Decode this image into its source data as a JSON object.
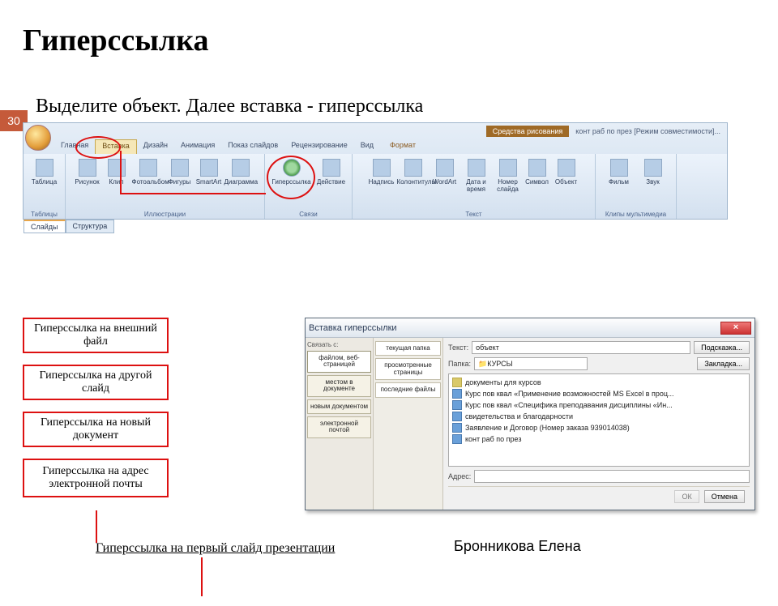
{
  "slide": {
    "title": "Гиперссылка",
    "page_number": "30",
    "instruction": "Выделите объект. Далее вставка - гиперссылка",
    "caption": "Гиперссылка на первый слайд презентации",
    "author": "Бронникова Елена"
  },
  "link_boxes": [
    "Гиперссылка на внешний файл",
    "Гиперссылка на другой слайд",
    "Гиперссылка на новый документ",
    "Гиперссылка на адрес электронной почты"
  ],
  "ribbon": {
    "tools_tab_title": "Средства рисования",
    "doc_name": "конт раб по през [Режим совместимости]...",
    "tabs": [
      "Главная",
      "Вставка",
      "Дизайн",
      "Анимация",
      "Показ слайдов",
      "Рецензирование",
      "Вид",
      "Формат"
    ],
    "active_tab_index": 1,
    "groups": {
      "tables": {
        "label": "Таблицы",
        "btn": "Таблица"
      },
      "illustrations": {
        "label": "Иллюстрации",
        "btns": [
          "Рисунок",
          "Клип",
          "Фотоальбом",
          "Фигуры",
          "SmartArt",
          "Диаграмма"
        ]
      },
      "links": {
        "label": "Связи",
        "btns": [
          "Гиперссылка",
          "Действие"
        ]
      },
      "text": {
        "label": "Текст",
        "btns": [
          "Надпись",
          "Колонтитулы",
          "WordArt",
          "Дата и время",
          "Номер слайда",
          "Символ",
          "Объект"
        ]
      },
      "media": {
        "label": "Клипы мультимедиа",
        "btns": [
          "Фильм",
          "Звук"
        ]
      }
    },
    "pane_tabs": [
      "Слайды",
      "Структура"
    ]
  },
  "dialog": {
    "title": "Вставка гиперссылки",
    "link_to_label": "Связать с:",
    "text_label": "Текст:",
    "text_value": "объект",
    "folder_label": "Папка:",
    "folder_value": "КУРСЫ",
    "address_label": "Адрес:",
    "address_value": "",
    "hint_btn": "Подсказка...",
    "bookmark_btn": "Закладка...",
    "ok_btn": "ОК",
    "cancel_btn": "Отмена",
    "left_panel": [
      "файлом, веб-страницей",
      "местом в документе",
      "новым документом",
      "электронной почтой"
    ],
    "mid_panel": [
      "текущая папка",
      "просмотренные страницы",
      "последние файлы"
    ],
    "files": [
      {
        "icon": "folder",
        "name": "документы для курсов"
      },
      {
        "icon": "doc",
        "name": "Курс пов квал «Применение возможностей MS Excel в проц..."
      },
      {
        "icon": "doc",
        "name": "Курс пов квал «Специфика преподавания дисциплины «Ин..."
      },
      {
        "icon": "doc",
        "name": "свидетельства и благодарности"
      },
      {
        "icon": "doc",
        "name": "Заявление и Договор (Номер заказа 939014038)"
      },
      {
        "icon": "doc",
        "name": "конт раб по през"
      }
    ]
  }
}
